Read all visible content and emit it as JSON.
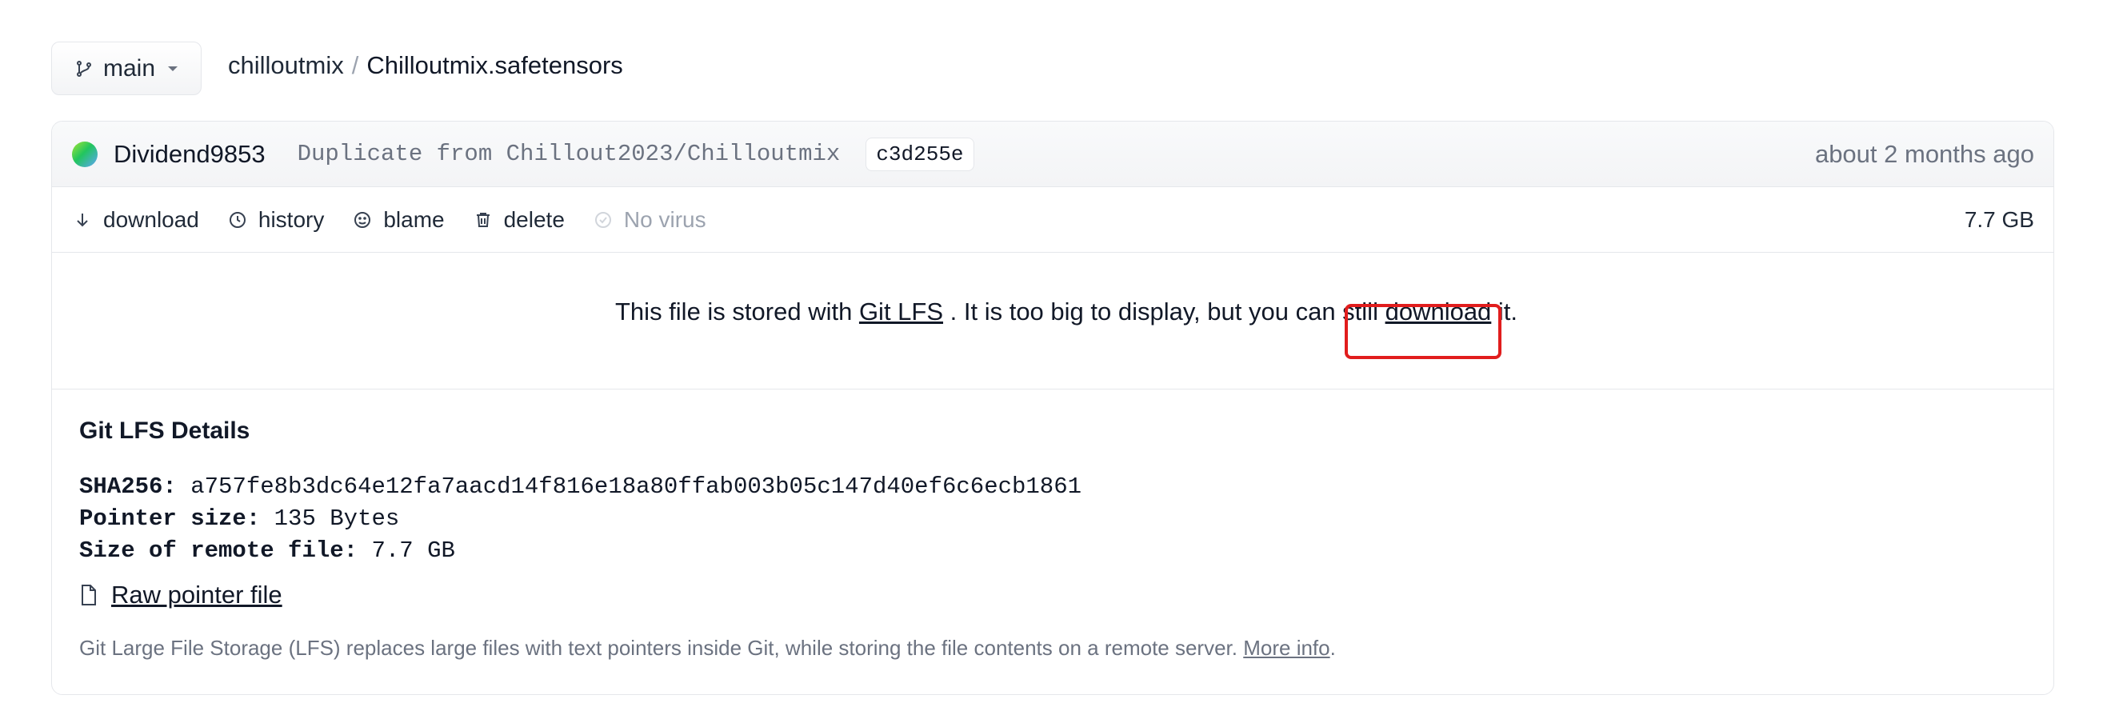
{
  "branch": {
    "label": "main"
  },
  "breadcrumb": {
    "repo": "chilloutmix",
    "separator": "/",
    "file": "Chilloutmix.safetensors"
  },
  "commit": {
    "author": "Dividend9853",
    "message": "Duplicate from Chillout2023/Chilloutmix",
    "sha": "c3d255e",
    "time": "about 2 months ago"
  },
  "actions": {
    "download": "download",
    "history": "history",
    "blame": "blame",
    "delete": "delete",
    "virus": "No virus",
    "size": "7.7 GB"
  },
  "notice": {
    "before": "This file is stored with ",
    "lfs_link": "Git LFS",
    "middle": " . It is too big to display, but you can still ",
    "download_link": "download",
    "after": " it."
  },
  "lfs_details": {
    "title": "Git LFS Details",
    "sha_label": "SHA256:",
    "sha_value": "a757fe8b3dc64e12fa7aacd14f816e18a80ffab003b05c147d40ef6c6ecb1861",
    "pointer_label": "Pointer size:",
    "pointer_value": "135 Bytes",
    "remote_label": "Size of remote file:",
    "remote_value": "7.7 GB",
    "raw_link": "Raw pointer file",
    "footer_text": "Git Large File Storage (LFS) replaces large files with text pointers inside Git, while storing the file contents on a remote server. ",
    "footer_link": "More info",
    "footer_end": "."
  },
  "colors": {
    "highlight": "#e11d1d",
    "muted": "#6b7280",
    "border": "#e5e7eb"
  }
}
